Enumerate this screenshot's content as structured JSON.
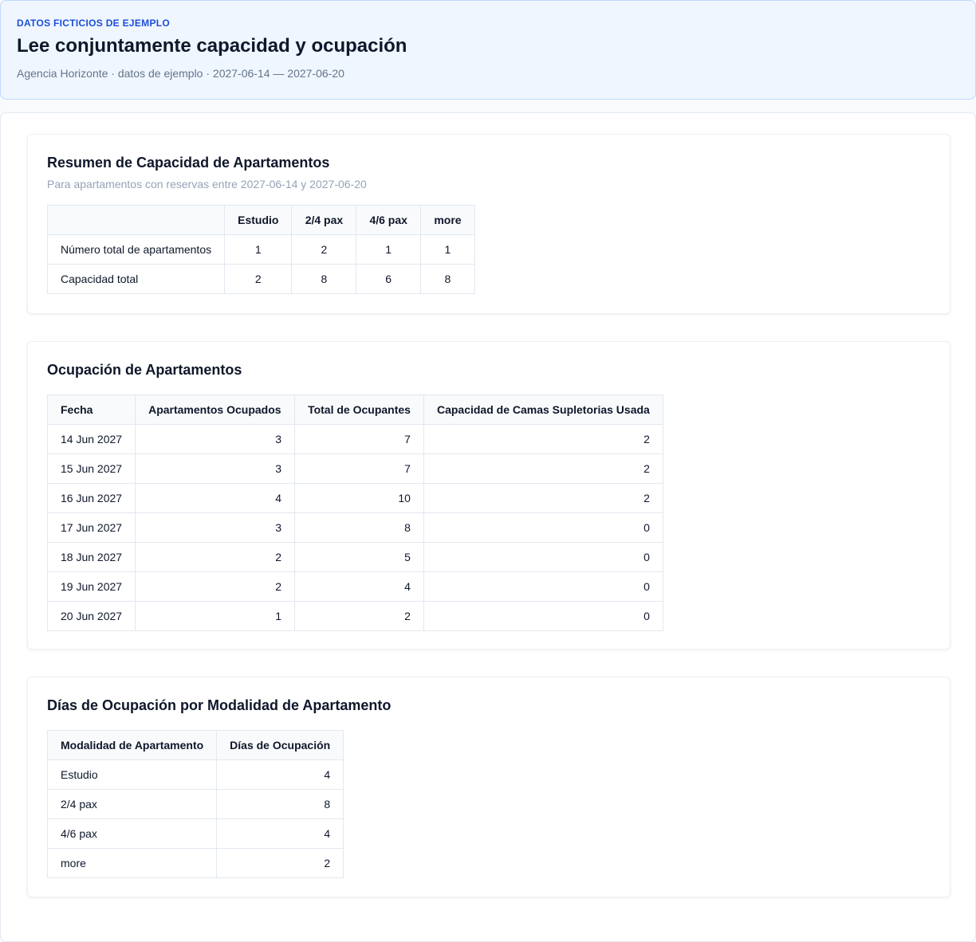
{
  "header": {
    "eyebrow": "DATOS FICTICIOS DE EJEMPLO",
    "title": "Lee conjuntamente capacidad y ocupación",
    "subtitle": "Agencia Horizonte · datos de ejemplo · 2027-06-14 — 2027-06-20"
  },
  "capacity": {
    "title": "Resumen de Capacidad de Apartamentos",
    "note": "Para apartamentos con reservas entre 2027-06-14 y 2027-06-20",
    "columns": [
      "",
      "Estudio",
      "2/4 pax",
      "4/6 pax",
      "more"
    ],
    "rows": [
      [
        "Número total de apartamentos",
        "1",
        "2",
        "1",
        "1"
      ],
      [
        "Capacidad total",
        "2",
        "8",
        "6",
        "8"
      ]
    ]
  },
  "occupancy": {
    "title": "Ocupación de Apartamentos",
    "columns": [
      "Fecha",
      "Apartamentos Ocupados",
      "Total de Ocupantes",
      "Capacidad de Camas Supletorias Usada"
    ],
    "rows": [
      [
        "14 Jun 2027",
        "3",
        "7",
        "2"
      ],
      [
        "15 Jun 2027",
        "3",
        "7",
        "2"
      ],
      [
        "16 Jun 2027",
        "4",
        "10",
        "2"
      ],
      [
        "17 Jun 2027",
        "3",
        "8",
        "0"
      ],
      [
        "18 Jun 2027",
        "2",
        "5",
        "0"
      ],
      [
        "19 Jun 2027",
        "2",
        "4",
        "0"
      ],
      [
        "20 Jun 2027",
        "1",
        "2",
        "0"
      ]
    ]
  },
  "days": {
    "title": "Días de Ocupación por Modalidad de Apartamento",
    "columns": [
      "Modalidad de Apartamento",
      "Días de Ocupación"
    ],
    "rows": [
      [
        "Estudio",
        "4"
      ],
      [
        "2/4 pax",
        "8"
      ],
      [
        "4/6 pax",
        "4"
      ],
      [
        "more",
        "2"
      ]
    ]
  }
}
